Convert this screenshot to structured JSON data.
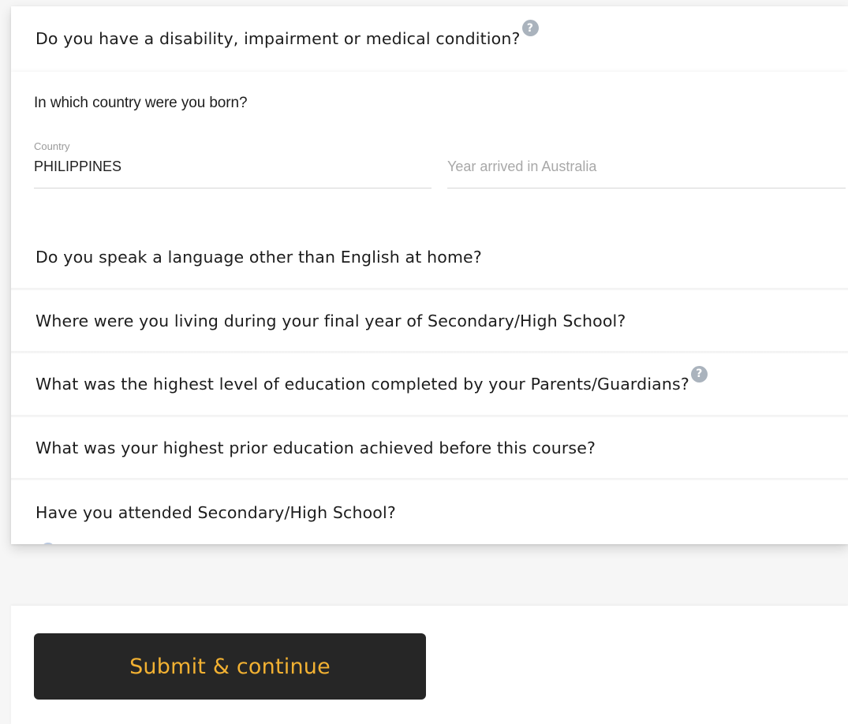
{
  "questions": {
    "disability": "Do you have a disability, impairment or medical condition?",
    "country_born": "In which country were you born?",
    "language": "Do you speak a language other than English at home?",
    "living": "Where were you living during your final year of Secondary/High School?",
    "parents_education": "What was the highest level of education completed by your Parents/Guardians?",
    "prior_education": "What was your highest prior education achieved before this course?",
    "secondary_school": "Have you attended Secondary/High School?"
  },
  "country_field": {
    "label": "Country",
    "value": "PHILIPPINES"
  },
  "year_field": {
    "placeholder": "Year arrived in Australia"
  },
  "help_icon": {
    "glyph": "?",
    "color": "#aab3bd"
  },
  "submit": {
    "label": "Submit & continue",
    "background": "#262626",
    "text_color": "#f2b132"
  }
}
